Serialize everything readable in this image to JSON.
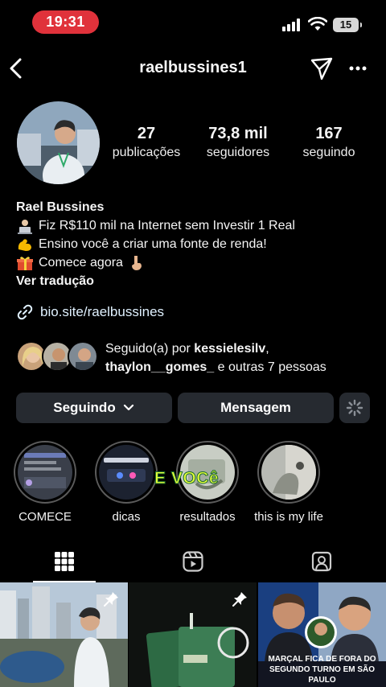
{
  "status": {
    "time": "19:31",
    "battery": "15"
  },
  "header": {
    "username": "raelbussines1"
  },
  "stats": [
    {
      "value": "27",
      "label": "publicações"
    },
    {
      "value": "73,8 mil",
      "label": "seguidores"
    },
    {
      "value": "167",
      "label": "seguindo"
    }
  ],
  "bio": {
    "name": "Rael Bussines",
    "lines": [
      "Fiz R$110 mil na Internet sem Investir 1 Real",
      "Ensino você a criar uma fonte de renda!",
      "Comece agora"
    ],
    "translate": "Ver tradução",
    "link": "bio.site/raelbussines"
  },
  "followed_by": {
    "prefix": "Seguido(a) por ",
    "user1": "kessielesilv",
    "sep": ",",
    "user2": "thaylon__gomes_",
    "suffix": " e outras 7 pessoas"
  },
  "actions": {
    "following": "Seguindo",
    "message": "Mensagem"
  },
  "highlights": [
    {
      "label": "COMECE"
    },
    {
      "label": "dicas"
    },
    {
      "label": "resultados"
    },
    {
      "label": "this is my life"
    }
  ],
  "highlight_overlay": "E VOCê",
  "posts": [
    {
      "pinned": true,
      "caption": ""
    },
    {
      "pinned": true,
      "caption": ""
    },
    {
      "pinned": false,
      "caption": "MARÇAL FICA DE FORA DO SEGUNDO TURNO EM SÃO PAULO"
    }
  ],
  "colors": {
    "accent_time_pill": "#e0323b",
    "button_bg": "#262a30",
    "link": "#e0f1ff"
  }
}
